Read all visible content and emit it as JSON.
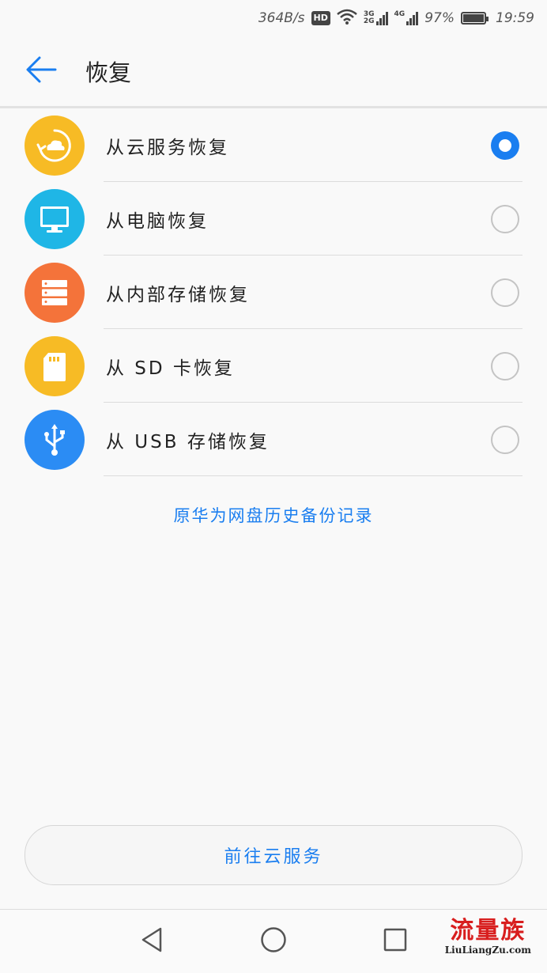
{
  "status_bar": {
    "speed": "364B/s",
    "hd_badge": "HD",
    "net_3g": "3G",
    "net_2g": "2G",
    "net_4g": "4G",
    "battery": "97%",
    "time": "19:59"
  },
  "header": {
    "title": "恢复",
    "back_icon": "arrow-left-icon"
  },
  "options": [
    {
      "label": "从云服务恢复",
      "icon": "cloud-restore-icon",
      "color": "#f7bb25",
      "selected": true
    },
    {
      "label": "从电脑恢复",
      "icon": "monitor-icon",
      "color": "#1fb6e6",
      "selected": false
    },
    {
      "label": "从内部存储恢复",
      "icon": "storage-icon",
      "color": "#f4733a",
      "selected": false
    },
    {
      "label": "从 SD 卡恢复",
      "icon": "sd-card-icon",
      "color": "#f7bb25",
      "selected": false
    },
    {
      "label": "从 USB 存储恢复",
      "icon": "usb-icon",
      "color": "#2b8cf4",
      "selected": false
    }
  ],
  "history_link": "原华为网盘历史备份记录",
  "cloud_button": "前往云服务",
  "accent_color": "#1a7ef0",
  "watermark": {
    "title": "流量族",
    "url": "LiuLiangZu.com"
  }
}
